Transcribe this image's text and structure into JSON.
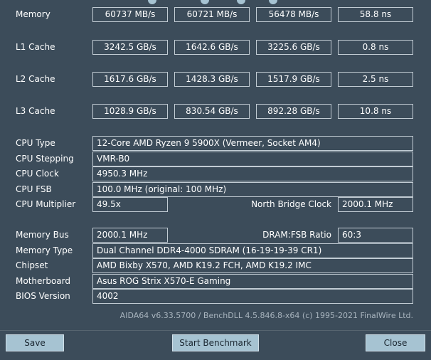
{
  "benchmarks": {
    "rows": [
      {
        "label": "Memory",
        "read": "60737 MB/s",
        "write": "60721 MB/s",
        "copy": "56478 MB/s",
        "latency": "58.8 ns"
      },
      {
        "label": "L1 Cache",
        "read": "3242.5 GB/s",
        "write": "1642.6 GB/s",
        "copy": "3225.6 GB/s",
        "latency": "0.8 ns"
      },
      {
        "label": "L2 Cache",
        "read": "1617.6 GB/s",
        "write": "1428.3 GB/s",
        "copy": "1517.9 GB/s",
        "latency": "2.5 ns"
      },
      {
        "label": "L3 Cache",
        "read": "1028.9 GB/s",
        "write": "830.54 GB/s",
        "copy": "892.28 GB/s",
        "latency": "10.8 ns"
      }
    ]
  },
  "cpu": {
    "type_label": "CPU Type",
    "type": "12-Core AMD Ryzen 9 5900X  (Vermeer, Socket AM4)",
    "stepping_label": "CPU Stepping",
    "stepping": "VMR-B0",
    "clock_label": "CPU Clock",
    "clock": "4950.3 MHz",
    "fsb_label": "CPU FSB",
    "fsb": "100.0 MHz  (original: 100 MHz)",
    "multiplier_label": "CPU Multiplier",
    "multiplier": "49.5x",
    "nb_clock_label": "North Bridge Clock",
    "nb_clock": "2000.1 MHz"
  },
  "system": {
    "membus_label": "Memory Bus",
    "membus": "2000.1 MHz",
    "ratio_label": "DRAM:FSB Ratio",
    "ratio": "60:3",
    "memtype_label": "Memory Type",
    "memtype": "Dual Channel DDR4-4000 SDRAM  (16-19-19-39 CR1)",
    "chipset_label": "Chipset",
    "chipset": "AMD Bixby X570, AMD K19.2 FCH, AMD K19.2 IMC",
    "motherboard_label": "Motherboard",
    "motherboard": "Asus ROG Strix X570-E Gaming",
    "bios_label": "BIOS Version",
    "bios": "4002"
  },
  "footer": {
    "text": "AIDA64 v6.33.5700 / BenchDLL 4.5.846.8-x64  (c) 1995-2021 FinalWire Ltd."
  },
  "buttons": {
    "save": "Save",
    "start": "Start Benchmark",
    "close": "Close"
  },
  "colors": {
    "background": "#3c4c5a",
    "button": "#a6c3d2",
    "box_border": "#c2ccd4"
  }
}
